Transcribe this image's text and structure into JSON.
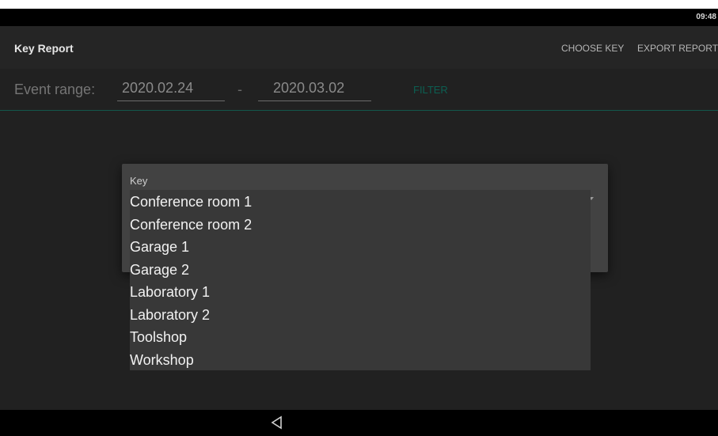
{
  "status_bar": {
    "time": "09:48"
  },
  "app_bar": {
    "title": "Key Report",
    "actions": {
      "choose_key": "CHOOSE KEY",
      "export_report": "EXPORT REPORT"
    }
  },
  "filter": {
    "label": "Event range:",
    "start_date": "2020.02.24",
    "separator": "-",
    "end_date": "2020.03.02",
    "button": "FILTER"
  },
  "dialog": {
    "field_label": "Key",
    "options": [
      "Conference room 1",
      "Conference room 2",
      "Garage 1",
      "Garage 2",
      "Laboratory 1",
      "Laboratory 2",
      "Toolshop",
      "Workshop"
    ]
  },
  "nav_bar": {
    "back_icon": "back-triangle-icon"
  },
  "colors": {
    "background": "#212121",
    "app_bar": "#252525",
    "dialog": "#424242",
    "dropdown": "#383838",
    "accent": "#0c5f52"
  }
}
